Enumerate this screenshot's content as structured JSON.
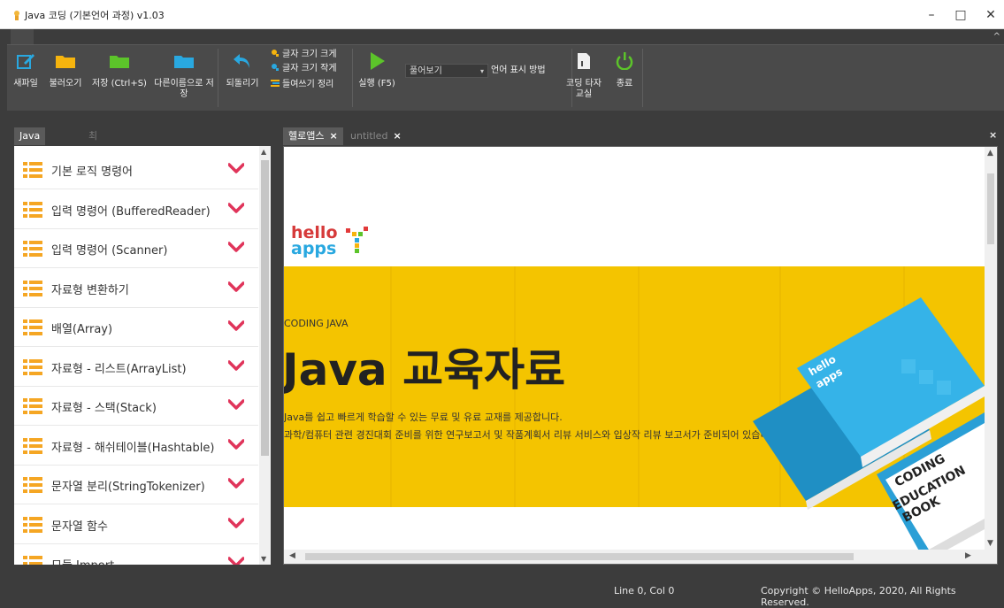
{
  "window": {
    "title": "Java 코딩 (기본언어 과정) v1.03",
    "minimize": "–",
    "maximize": "□",
    "close": "✕",
    "ribbon_collapse": "^"
  },
  "toolbar": {
    "new_label": "새파일",
    "open_label": "불러오기",
    "save_label": "저장 (Ctrl+S)",
    "save_as_label": "다른이름으로 저장",
    "undo_label": "되돌리기",
    "font_bigger_label": "글자 크기 크게",
    "font_smaller_label": "글자 크기 작게",
    "indent_label": "들여쓰기 정리",
    "run_label": "실행 (F5)",
    "view_select_value": "풀어보기",
    "lang_display_label": "언어 표시 방법",
    "typing_label": "코딩 타자교실",
    "exit_label": "종료"
  },
  "left_panel": {
    "tabs": [
      "Java 명령어",
      "최근 파일"
    ],
    "items": [
      {
        "label": "기본 로직 명령어"
      },
      {
        "label": "입력 명령어 (BufferedReader)"
      },
      {
        "label": "입력 명령어 (Scanner)"
      },
      {
        "label": "자료형 변환하기"
      },
      {
        "label": "배열(Array)"
      },
      {
        "label": "자료형 - 리스트(ArrayList)"
      },
      {
        "label": "자료형 - 스택(Stack)"
      },
      {
        "label": "자료형 - 해쉬테이블(Hashtable)"
      },
      {
        "label": "문자열 분리(StringTokenizer)"
      },
      {
        "label": "문자열 함수"
      },
      {
        "label": "모듈 Import"
      }
    ]
  },
  "editor": {
    "tabs": [
      {
        "label": "헬로앱스",
        "close": "×"
      },
      {
        "label": "untitled",
        "close": "×"
      }
    ],
    "panel_close": "×"
  },
  "content": {
    "logo_line1": "hello",
    "logo_line2": "apps",
    "eyebrow": "CODING JAVA",
    "headline": "Java 교육자료",
    "line1": "Java를 쉽고 빠르게 학습할 수 있는 무료 및 유료 교재를 제공합니다.",
    "line2": "과학/컴퓨터 관련 경진대회 준비를 위한 연구보고서 및 작품계획서 리뷰 서비스와 입상작 리뷰 보고서가 준비되어 있습니다.",
    "book_brand1": "hello",
    "book_brand2": "apps",
    "book_title1": "CODING",
    "book_title2": "EDUCATION",
    "book_title3": "BOOK"
  },
  "status": {
    "position": "Line 0, Col 0",
    "copyright": "Copyright © HelloApps, 2020, All Rights Reserved."
  },
  "colors": {
    "accent_yellow": "#f4c400",
    "chevron": "#e0345a",
    "list_icon": "#f5a623",
    "book_blue": "#29a8e0"
  }
}
